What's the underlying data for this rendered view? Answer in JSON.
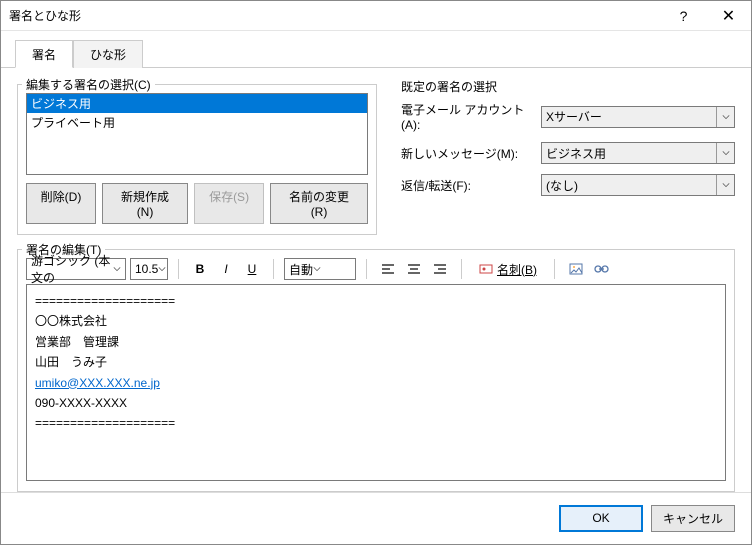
{
  "window": {
    "title": "署名とひな形",
    "help": "?",
    "close": "✕"
  },
  "tabs": {
    "signature": "署名",
    "stationery": "ひな形"
  },
  "left": {
    "legend": "編集する署名の選択(C)",
    "items": [
      "ビジネス用",
      "プライベート用"
    ],
    "selected_index": 0,
    "buttons": {
      "delete": "削除(D)",
      "new": "新規作成(N)",
      "save": "保存(S)",
      "rename": "名前の変更(R)"
    }
  },
  "right": {
    "legend": "既定の署名の選択",
    "account_label": "電子メール アカウント(A):",
    "account_value": "Xサーバー",
    "newmsg_label": "新しいメッセージ(M):",
    "newmsg_value": "ビジネス用",
    "reply_label": "返信/転送(F):",
    "reply_value": "(なし)"
  },
  "editor": {
    "legend": "署名の編集(T)",
    "font": "游ゴシック (本文の",
    "size": "10.5",
    "color": "自動",
    "card_label": "名刺(B)",
    "content": {
      "sep": "====================",
      "company": "〇〇株式会社",
      "dept": "営業部　管理課",
      "name": "山田　うみ子",
      "email": "umiko@XXX.XXX.ne.jp",
      "phone": "090-XXXX-XXXX"
    }
  },
  "footer": {
    "ok": "OK",
    "cancel": "キャンセル"
  }
}
